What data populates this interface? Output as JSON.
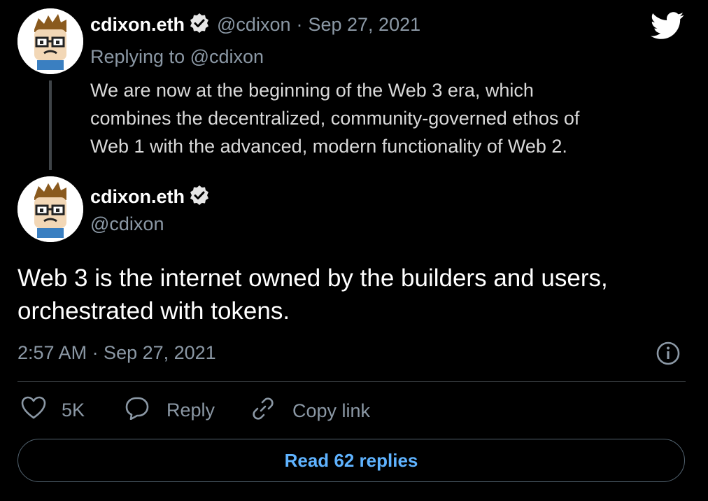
{
  "parent_tweet": {
    "display_name": "cdixon.eth",
    "handle": "@cdixon",
    "separator": "·",
    "date": "Sep 27, 2021",
    "replying_to": "Replying to @cdixon",
    "lines": [
      "We are now at the beginning of the Web 3 era, which",
      "combines the decentralized, community-governed ethos of",
      "Web 1 with the advanced, modern functionality of Web 2."
    ]
  },
  "main_tweet": {
    "display_name": "cdixon.eth",
    "handle": "@cdixon",
    "lines": [
      "Web 3 is the internet owned by the builders and users,",
      "orchestrated with tokens."
    ],
    "timestamp": "2:57 AM · Sep 27, 2021"
  },
  "actions": {
    "like_count": "5K",
    "reply_label": "Reply",
    "copy_link_label": "Copy link"
  },
  "read_replies_label": "Read 62 replies",
  "colors": {
    "background": "#000000",
    "muted": "#8b98a5",
    "accent": "#5fb3ff",
    "twitter_logo": "#ffffff"
  },
  "icons": {
    "logo": "twitter-bird-icon",
    "verified": "verified-badge-icon",
    "info": "info-icon",
    "like": "heart-icon",
    "reply": "speech-bubble-icon",
    "copy_link": "link-icon"
  }
}
